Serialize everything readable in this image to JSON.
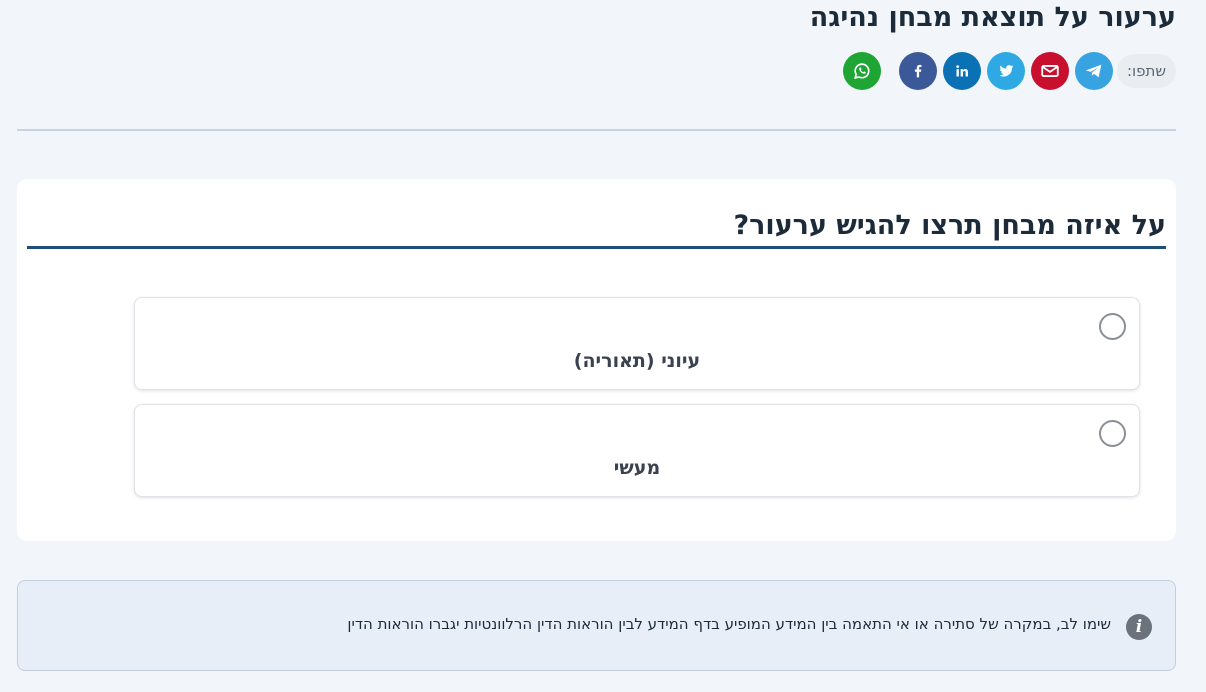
{
  "header": {
    "title": "ערעור על תוצאת מבחן נהיגה",
    "share_label": "שתפו:"
  },
  "share_buttons": [
    {
      "name": "telegram",
      "icon": "telegram-icon",
      "color": "#37a3e0"
    },
    {
      "name": "email",
      "icon": "envelope-icon",
      "color": "#c8102e"
    },
    {
      "name": "twitter",
      "icon": "twitter-icon",
      "color": "#2fa9e4"
    },
    {
      "name": "linkedin",
      "icon": "linkedin-icon",
      "color": "#0a71b5"
    },
    {
      "name": "facebook",
      "icon": "facebook-icon",
      "color": "#3b5998"
    },
    {
      "name": "whatsapp",
      "icon": "whatsapp-icon",
      "color": "#1ea533"
    }
  ],
  "question": {
    "title": "על איזה מבחן תרצו להגיש ערעור?",
    "options": [
      {
        "label": "עיוני (תאוריה)",
        "selected": false
      },
      {
        "label": "מעשי",
        "selected": false
      }
    ]
  },
  "notice": {
    "icon": "info-icon",
    "text": "שימו לב, במקרה של סתירה או אי התאמה בין המידע המופיע בדף המידע לבין הוראות הדין הרלוונטיות יגברו הוראות הדין"
  },
  "colors": {
    "background": "#f2f6fb",
    "accent_line": "#1f4e79",
    "title_text": "#1c2b3a"
  }
}
